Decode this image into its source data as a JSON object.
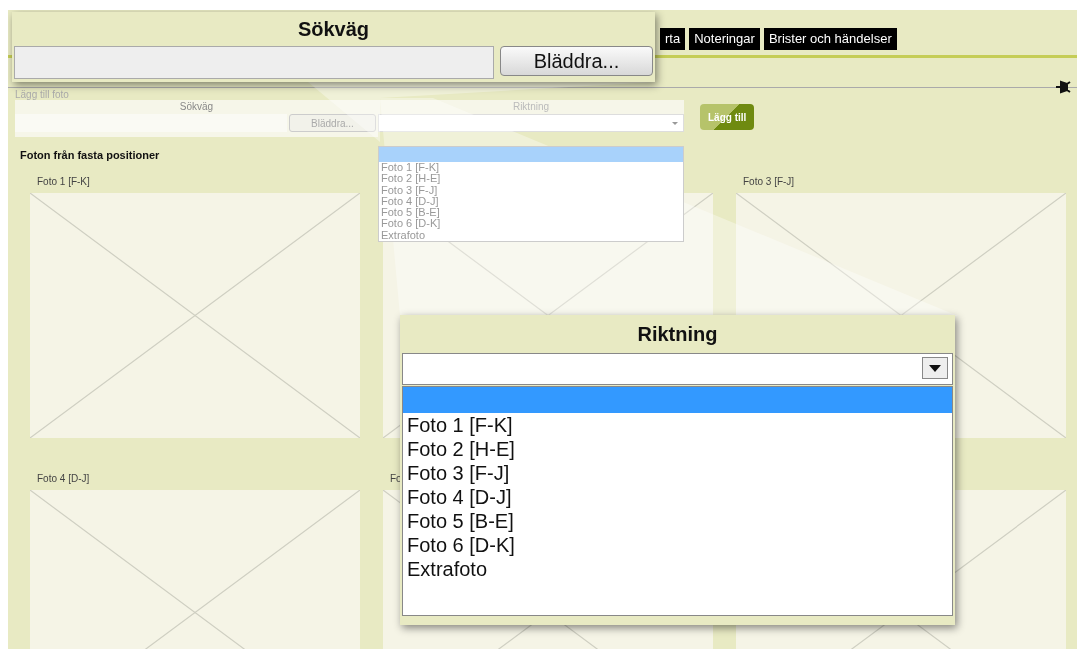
{
  "tabs": [
    {
      "label": "rta"
    },
    {
      "label": "Noteringar"
    },
    {
      "label": "Brister och händelser"
    }
  ],
  "add_photo_form": {
    "title": "Lägg till foto",
    "path_label": "Sökväg",
    "browse_button": "Bläddra...",
    "direction_label": "Riktning",
    "blank_option_highlighted": true,
    "direction_options": [
      "Foto 1 [F-K]",
      "Foto 2 [H-E]",
      "Foto 3 [F-J]",
      "Foto 4 [D-J]",
      "Foto 5 [B-E]",
      "Foto 6 [D-K]",
      "Extrafoto"
    ],
    "add_button": "Lägg till"
  },
  "fixed_photos": {
    "title": "Foton från fasta positioner",
    "photos": [
      {
        "kind": "placeholder",
        "label": "Foto 1 [F-K]"
      },
      {
        "kind": "placeholder"
      },
      {
        "kind": "placeholder",
        "label": "Foto 3 [F-J]"
      },
      {
        "kind": "placeholder",
        "label": "Foto 4 [D-J]"
      },
      {
        "kind": "placeholder",
        "label": "Fo"
      },
      {
        "kind": "placeholder"
      }
    ]
  },
  "callouts": [
    {
      "kind": "path",
      "title": "Sökväg",
      "button": "Bläddra..."
    },
    {
      "kind": "direction",
      "title": "Riktning",
      "blank_option_highlighted": true,
      "options": [
        "Foto 1 [F-K]",
        "Foto 2 [H-E]",
        "Foto 3 [F-J]",
        "Foto 4 [D-J]",
        "Foto 5 [B-E]",
        "Foto 6 [D-K]",
        "Extrafoto"
      ]
    }
  ]
}
